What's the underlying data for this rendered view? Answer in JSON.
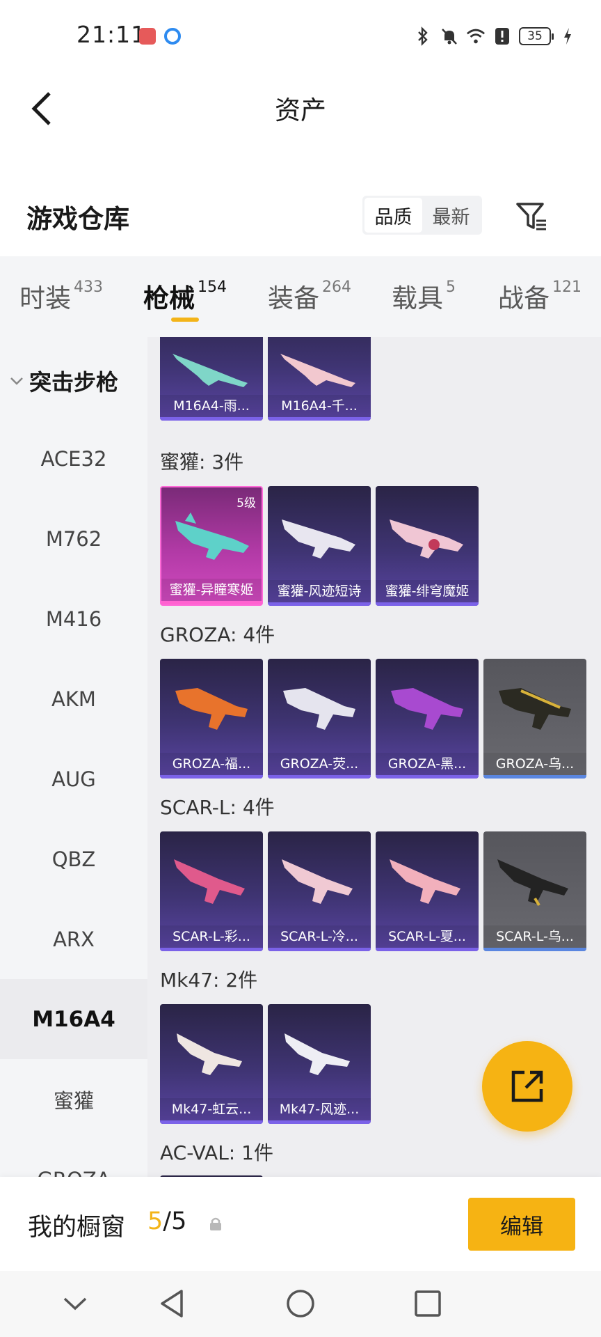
{
  "status_bar": {
    "time": "21:11",
    "battery": "35"
  },
  "header": {
    "title": "资产"
  },
  "warehouse": {
    "title": "游戏仓库",
    "sort_options": [
      "品质",
      "最新"
    ],
    "active_sort": "品质"
  },
  "tabs": [
    {
      "label": "时装",
      "count": "433"
    },
    {
      "label": "枪械",
      "count": "154",
      "active": true
    },
    {
      "label": "装备",
      "count": "264"
    },
    {
      "label": "载具",
      "count": "5"
    },
    {
      "label": "战备",
      "count": "121"
    }
  ],
  "sidebar": {
    "group_label": "突击步枪",
    "items": [
      "ACE32",
      "M762",
      "M416",
      "AKM",
      "AUG",
      "QBZ",
      "ARX",
      "M16A4",
      "蜜獾",
      "GROZA"
    ],
    "active": "M16A4"
  },
  "sections": [
    {
      "title": "",
      "items": [
        {
          "name": "M16A4-雨...",
          "quality": "purple"
        },
        {
          "name": "M16A4-千...",
          "quality": "purple"
        }
      ]
    },
    {
      "title": "蜜獾: 3件",
      "items": [
        {
          "name": "蜜獾-异瞳寒姬",
          "quality": "pink",
          "level": "5级"
        },
        {
          "name": "蜜獾-风迹短诗",
          "quality": "purple"
        },
        {
          "name": "蜜獾-绯穹魔姬",
          "quality": "purple"
        }
      ]
    },
    {
      "title": "GROZA: 4件",
      "items": [
        {
          "name": "GROZA-福...",
          "quality": "purple"
        },
        {
          "name": "GROZA-荧...",
          "quality": "purple"
        },
        {
          "name": "GROZA-黑...",
          "quality": "purple"
        },
        {
          "name": "GROZA-乌...",
          "quality": "gray"
        }
      ]
    },
    {
      "title": "SCAR-L: 4件",
      "items": [
        {
          "name": "SCAR-L-彩...",
          "quality": "purple"
        },
        {
          "name": "SCAR-L-冷...",
          "quality": "purple"
        },
        {
          "name": "SCAR-L-夏...",
          "quality": "purple"
        },
        {
          "name": "SCAR-L-乌...",
          "quality": "gray"
        }
      ]
    },
    {
      "title": "Mk47: 2件",
      "items": [
        {
          "name": "Mk47-虹云...",
          "quality": "purple"
        },
        {
          "name": "Mk47-风迹...",
          "quality": "purple"
        }
      ]
    },
    {
      "title": "AC-VAL: 1件",
      "items": []
    }
  ],
  "showcase": {
    "label": "我的橱窗",
    "current": "5",
    "total": "/5",
    "edit_label": "编辑"
  },
  "colors": {
    "accent": "#f6b313",
    "card_purple": "#4a3c86",
    "card_pink": "#c23fb3",
    "card_gray": "#5f5f65"
  }
}
